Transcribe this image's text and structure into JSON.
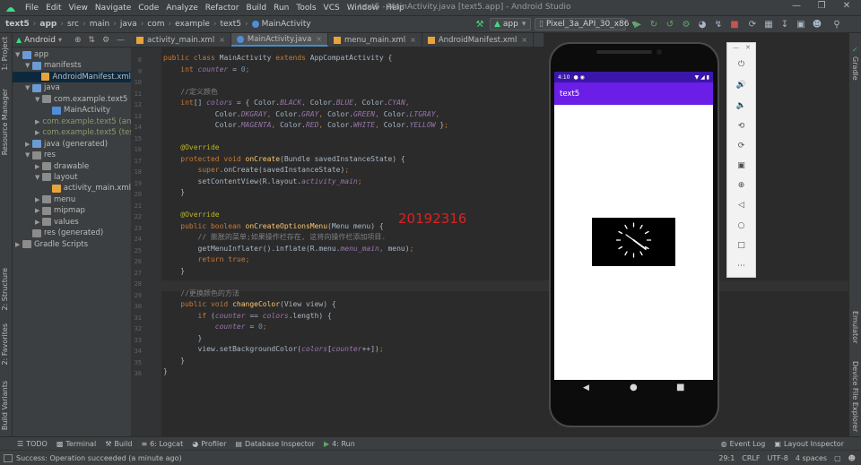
{
  "menubar": {
    "items": [
      "File",
      "Edit",
      "View",
      "Navigate",
      "Code",
      "Analyze",
      "Refactor",
      "Build",
      "Run",
      "Tools",
      "VCS",
      "Window",
      "Help"
    ],
    "window_title": "text5 - MainActivity.java [text5.app] - Android Studio"
  },
  "breadcrumbs": [
    "text5",
    "app",
    "src",
    "main",
    "java",
    "com",
    "example",
    "text5",
    "MainActivity"
  ],
  "toolbar": {
    "run_config": "app",
    "device": "Pixel_3a_API_30_x86"
  },
  "project_panel": {
    "view_mode": "Android",
    "tree": [
      {
        "label": "app",
        "level": 0,
        "arrow": "▼",
        "icon": "fold-b"
      },
      {
        "label": "manifests",
        "level": 1,
        "arrow": "▼",
        "icon": "fold-b"
      },
      {
        "label": "AndroidManifest.xml",
        "level": 2,
        "arrow": "",
        "icon": "xml",
        "selected": true
      },
      {
        "label": "java",
        "level": 1,
        "arrow": "▼",
        "icon": "fold-b"
      },
      {
        "label": "com.example.text5",
        "level": 2,
        "arrow": "▼",
        "icon": "fold"
      },
      {
        "label": "MainActivity",
        "level": 3,
        "arrow": "",
        "icon": "cls"
      },
      {
        "label": "com.example.text5 (androidTest)",
        "level": 2,
        "arrow": "▶",
        "icon": "fold-g",
        "dim": true
      },
      {
        "label": "com.example.text5 (test)",
        "level": 2,
        "arrow": "▶",
        "icon": "fold-g",
        "dim": true
      },
      {
        "label": "java (generated)",
        "level": 1,
        "arrow": "▶",
        "icon": "fold-b"
      },
      {
        "label": "res",
        "level": 1,
        "arrow": "▼",
        "icon": "fold"
      },
      {
        "label": "drawable",
        "level": 2,
        "arrow": "▶",
        "icon": "fold"
      },
      {
        "label": "layout",
        "level": 2,
        "arrow": "▼",
        "icon": "fold"
      },
      {
        "label": "activity_main.xml",
        "level": 3,
        "arrow": "",
        "icon": "xml"
      },
      {
        "label": "menu",
        "level": 2,
        "arrow": "▶",
        "icon": "fold"
      },
      {
        "label": "mipmap",
        "level": 2,
        "arrow": "▶",
        "icon": "fold"
      },
      {
        "label": "values",
        "level": 2,
        "arrow": "▶",
        "icon": "fold"
      },
      {
        "label": "res (generated)",
        "level": 1,
        "arrow": "",
        "icon": "fold"
      },
      {
        "label": "Gradle Scripts",
        "level": 0,
        "arrow": "▶",
        "icon": "fold"
      }
    ]
  },
  "left_tool_labels": [
    "1: Project",
    "Resource Manager",
    "2: Structure",
    "2: Favorites",
    "Build Variants"
  ],
  "right_tool_labels": [
    "Gradle",
    "Emulator",
    "Device File Explorer"
  ],
  "editor_tabs": [
    {
      "label": "activity_main.xml",
      "icon": "xml",
      "active": false
    },
    {
      "label": "MainActivity.java",
      "icon": "cls",
      "active": true
    },
    {
      "label": "menu_main.xml",
      "icon": "xml",
      "active": false
    },
    {
      "label": "AndroidManifest.xml",
      "icon": "xml",
      "active": false
    }
  ],
  "code": {
    "lines": [
      {
        "num": "8",
        "segs": [
          [
            "k",
            "public class "
          ],
          [
            "",
            "MainActivity "
          ],
          [
            "k",
            "extends "
          ],
          [
            "",
            "AppCompatActivity {"
          ]
        ]
      },
      {
        "num": "9",
        "segs": [
          [
            "",
            "    "
          ],
          [
            "k",
            "int "
          ],
          [
            "it",
            "counter"
          ],
          [
            "",
            " = "
          ],
          [
            "n",
            "0"
          ],
          [
            "k",
            ";"
          ]
        ]
      },
      {
        "num": "10",
        "segs": []
      },
      {
        "num": "11",
        "segs": [
          [
            "c",
            "    //定义颜色"
          ]
        ]
      },
      {
        "num": "12",
        "segs": [
          [
            "",
            "    "
          ],
          [
            "k",
            "int"
          ],
          [
            "",
            "[] "
          ],
          [
            "it",
            "colors"
          ],
          [
            "",
            " = { Color."
          ],
          [
            "it",
            "BLACK"
          ],
          [
            "k",
            ", "
          ],
          [
            "",
            "Color."
          ],
          [
            "it",
            "BLUE"
          ],
          [
            "k",
            ", "
          ],
          [
            "",
            "Color."
          ],
          [
            "it",
            "CYAN"
          ],
          [
            "k",
            ","
          ]
        ]
      },
      {
        "num": "13",
        "segs": [
          [
            "",
            "            Color."
          ],
          [
            "it",
            "DKGRAY"
          ],
          [
            "k",
            ", "
          ],
          [
            "",
            "Color."
          ],
          [
            "it",
            "GRAY"
          ],
          [
            "k",
            ", "
          ],
          [
            "",
            "Color."
          ],
          [
            "it",
            "GREEN"
          ],
          [
            "k",
            ", "
          ],
          [
            "",
            "Color."
          ],
          [
            "it",
            "LTGRAY"
          ],
          [
            "k",
            ","
          ]
        ]
      },
      {
        "num": "14",
        "segs": [
          [
            "",
            "            Color."
          ],
          [
            "it",
            "MAGENTA"
          ],
          [
            "k",
            ", "
          ],
          [
            "",
            "Color."
          ],
          [
            "it",
            "RED"
          ],
          [
            "k",
            ", "
          ],
          [
            "",
            "Color."
          ],
          [
            "it",
            "WHITE"
          ],
          [
            "k",
            ", "
          ],
          [
            "",
            "Color."
          ],
          [
            "it",
            "YELLOW"
          ],
          [
            "",
            " }"
          ],
          [
            "k",
            ";"
          ]
        ]
      },
      {
        "num": "15",
        "segs": []
      },
      {
        "num": "16",
        "segs": [
          [
            "an",
            "    @Override"
          ]
        ]
      },
      {
        "num": "17",
        "segs": [
          [
            "",
            "    "
          ],
          [
            "k",
            "protected void "
          ],
          [
            "f",
            "onCreate"
          ],
          [
            "",
            "(Bundle savedInstanceState) {"
          ]
        ]
      },
      {
        "num": "18",
        "segs": [
          [
            "",
            "        "
          ],
          [
            "k",
            "super"
          ],
          [
            "",
            ".onCreate(savedInstanceState)"
          ],
          [
            "k",
            ";"
          ]
        ]
      },
      {
        "num": "19",
        "segs": [
          [
            "",
            "        setContentView(R.layout."
          ],
          [
            "it",
            "activity_main"
          ],
          [
            ")"
          ],
          [
            "k",
            ";"
          ]
        ]
      },
      {
        "num": "20",
        "segs": [
          [
            "",
            "    }"
          ]
        ]
      },
      {
        "num": "21",
        "segs": []
      },
      {
        "num": "22",
        "segs": [
          [
            "an",
            "    @Override"
          ]
        ]
      },
      {
        "num": "23",
        "segs": [
          [
            "",
            "    "
          ],
          [
            "k",
            "public boolean "
          ],
          [
            "f",
            "onCreateOptionsMenu"
          ],
          [
            "",
            "(Menu menu) {"
          ]
        ]
      },
      {
        "num": "24",
        "segs": [
          [
            "c",
            "        // 膨胀的菜单;如果操作栏存在, 这将向操作栏添加项目."
          ]
        ]
      },
      {
        "num": "25",
        "segs": [
          [
            "",
            "        getMenuInflater().inflate(R.menu."
          ],
          [
            "it",
            "menu_main"
          ],
          [
            "k",
            ", "
          ],
          [
            "",
            "menu)"
          ],
          [
            "k",
            ";"
          ]
        ]
      },
      {
        "num": "26",
        "segs": [
          [
            "",
            "        "
          ],
          [
            "k",
            "return true;"
          ]
        ]
      },
      {
        "num": "27",
        "segs": [
          [
            "",
            "    }"
          ]
        ]
      },
      {
        "num": "28",
        "segs": []
      },
      {
        "num": "29",
        "segs": [
          [
            "c",
            "    //更换颜色的方法"
          ]
        ]
      },
      {
        "num": "30",
        "segs": [
          [
            "",
            "    "
          ],
          [
            "k",
            "public void "
          ],
          [
            "f",
            "changeColor"
          ],
          [
            "",
            "(View view) {"
          ]
        ]
      },
      {
        "num": "31",
        "segs": [
          [
            "",
            "        "
          ],
          [
            "k",
            "if "
          ],
          [
            "",
            "("
          ],
          [
            "it",
            "counter"
          ],
          [
            "",
            " == "
          ],
          [
            "it",
            "colors"
          ],
          [
            "",
            ".length) {"
          ]
        ]
      },
      {
        "num": "32",
        "segs": [
          [
            "",
            "            "
          ],
          [
            "it",
            "counter"
          ],
          [
            "",
            " = "
          ],
          [
            "n",
            "0"
          ],
          [
            "k",
            ";"
          ]
        ]
      },
      {
        "num": "33",
        "segs": [
          [
            "",
            "        }"
          ]
        ]
      },
      {
        "num": "34",
        "segs": [
          [
            "",
            "        view.setBackgroundColor("
          ],
          [
            "it",
            "colors"
          ],
          [
            "",
            "["
          ],
          [
            "it",
            "counter"
          ],
          [
            "",
            "++])"
          ],
          [
            "k",
            ";"
          ]
        ]
      },
      {
        "num": "35",
        "segs": [
          [
            "",
            "    }"
          ]
        ]
      },
      {
        "num": "36",
        "segs": [
          [
            "",
            "}"
          ]
        ]
      }
    ]
  },
  "watermark": "20192316",
  "emulator": {
    "time": "4:10",
    "app_title": "text5"
  },
  "emulator_controls": [
    "power-icon",
    "volume-up-icon",
    "volume-down-icon",
    "rotate-left-icon",
    "rotate-right-icon",
    "camera-icon",
    "zoom-icon",
    "back-icon",
    "home-icon",
    "overview-icon",
    "more-icon"
  ],
  "bottom_tools": {
    "left": [
      "TODO",
      "Terminal",
      "Build",
      "6: Logcat",
      "Profiler",
      "Database Inspector",
      "4: Run"
    ],
    "right": [
      "Event Log",
      "Layout Inspector"
    ]
  },
  "status": {
    "message": "Success: Operation succeeded (a minute ago)",
    "position": "29:1",
    "line_sep": "CRLF",
    "encoding": "UTF-8",
    "indent": "4 spaces"
  },
  "colors": {
    "accent": "#6a1ee6",
    "statusbar": "#3a17a8",
    "watermark": "#e02020"
  }
}
